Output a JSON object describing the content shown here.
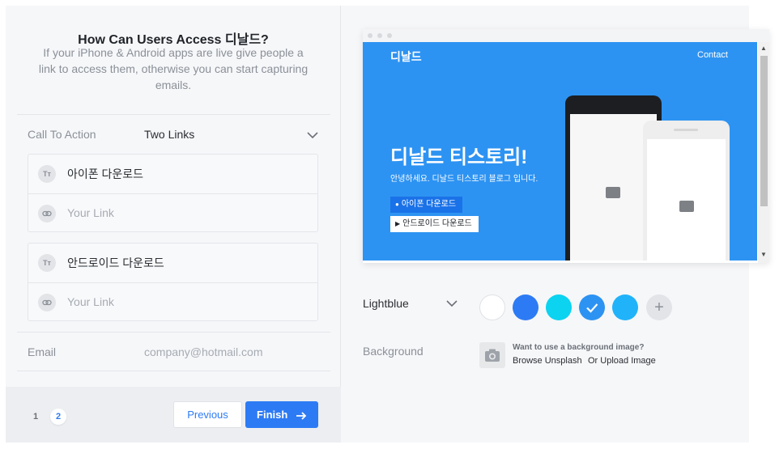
{
  "form": {
    "title": "How Can Users Access 디날드?",
    "subtitle": "If your iPhone & Android apps are live give people a link to access them, otherwise you can start capturing emails.",
    "cta_label": "Call To Action",
    "cta_value": "Two Links",
    "links": [
      {
        "name": "아이폰 다운로드",
        "url_placeholder": "Your Link"
      },
      {
        "name": "안드로이드 다운로드",
        "url_placeholder": "Your Link"
      }
    ],
    "email_label": "Email",
    "email_value": "company@hotmail.com",
    "text_icon": "Tт"
  },
  "footer": {
    "pages": [
      "1",
      "2"
    ],
    "active_page": "2",
    "previous_label": "Previous",
    "finish_label": "Finish"
  },
  "preview": {
    "logo": "디날드",
    "contact": "Contact",
    "headline": "디날드 티스토리!",
    "subline": "안녕하세요. 디날드 티스토리 블로그 입니다.",
    "button_ios": "아이폰 다운로드",
    "button_android": "안드로이드 다운로드",
    "hero_color": "#2d93f2"
  },
  "theme": {
    "selected": "Lightblue",
    "swatches": [
      "#ffffff",
      "#2d7bf4",
      "#0bd3f0",
      "#2d93f2",
      "#20b3fa"
    ],
    "selected_swatch": 3,
    "add_label": "+"
  },
  "background": {
    "label": "Background",
    "question": "Want to use a background image?",
    "browse": "Browse Unsplash",
    "upload": "Or Upload Image"
  }
}
